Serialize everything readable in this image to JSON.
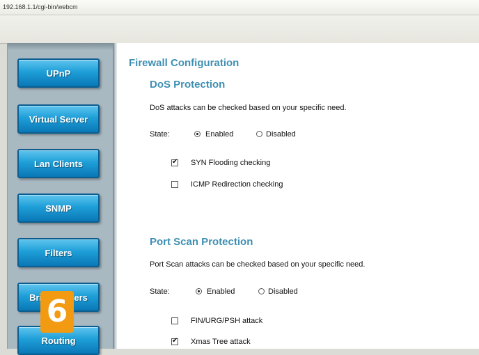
{
  "browser": {
    "address": "192.168.1.1/cgi-bin/webcm"
  },
  "sidebar": {
    "items": [
      {
        "label": "UPnP"
      },
      {
        "label": "Virtual Server"
      },
      {
        "label": "Lan Clients"
      },
      {
        "label": "SNMP"
      },
      {
        "label": "Filters"
      },
      {
        "label": "Bridge Filters"
      },
      {
        "label": "Routing"
      }
    ]
  },
  "badge": {
    "text": "6",
    "color": "#f29a12"
  },
  "main": {
    "title": "Firewall Configuration",
    "dos": {
      "heading": "DoS Protection",
      "description": "DoS attacks can be checked based on your specific need.",
      "state_label": "State:",
      "enabled_label": "Enabled",
      "disabled_label": "Disabled",
      "state_value": "Enabled",
      "checks": [
        {
          "label": "SYN Flooding checking",
          "checked": true
        },
        {
          "label": "ICMP Redirection checking",
          "checked": false
        }
      ]
    },
    "portscan": {
      "heading": "Port Scan Protection",
      "description": "Port Scan attacks can be checked based on your specific need.",
      "state_label": "State:",
      "enabled_label": "Enabled",
      "disabled_label": "Disabled",
      "state_value": "Enabled",
      "checks": [
        {
          "label": "FIN/URG/PSH attack",
          "checked": false
        },
        {
          "label": "Xmas Tree attack",
          "checked": true
        }
      ]
    }
  },
  "colors": {
    "accent": "#3f8fb3",
    "nav_button": "#1e9fd8",
    "sidebar_bg": "#a9b9c2"
  }
}
